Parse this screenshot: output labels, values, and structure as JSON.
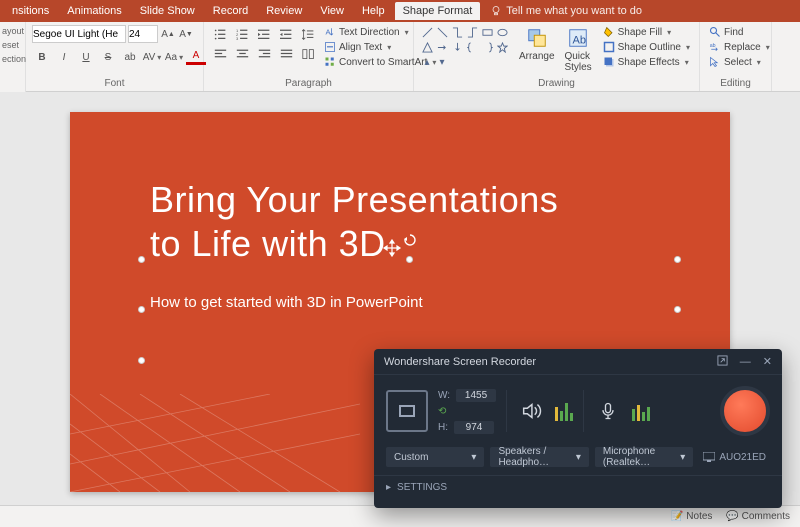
{
  "menu": {
    "items": [
      "nsitions",
      "Animations",
      "Slide Show",
      "Record",
      "Review",
      "View",
      "Help",
      "Shape Format"
    ],
    "active_index": 7,
    "tell_me": "Tell me what you want to do"
  },
  "left_stub": {
    "a": "ayout",
    "b": "eset",
    "c": "ection"
  },
  "ribbon": {
    "font": {
      "label": "Font",
      "family": "Segoe UI Light (He",
      "size": "24",
      "bold": "B",
      "italic": "I",
      "underline": "U",
      "strike": "S"
    },
    "paragraph": {
      "label": "Paragraph",
      "text_direction": "Text Direction",
      "align_text": "Align Text",
      "convert_smartart": "Convert to SmartArt"
    },
    "drawing": {
      "label": "Drawing",
      "arrange": "Arrange",
      "quick_styles": "Quick\nStyles",
      "shape_fill": "Shape Fill",
      "shape_outline": "Shape Outline",
      "shape_effects": "Shape Effects"
    },
    "editing": {
      "label": "Editing",
      "find": "Find",
      "replace": "Replace",
      "select": "Select"
    }
  },
  "slide": {
    "title": "Bring Your Presentations\nto Life with 3D",
    "subtitle": "How to get started with 3D in PowerPoint"
  },
  "status": {
    "notes": "Notes",
    "comments": "Comments"
  },
  "recorder": {
    "title": "Wondershare Screen Recorder",
    "w_label": "W:",
    "h_label": "H:",
    "lock_icon": "link-icon",
    "width": "1455",
    "height": "974",
    "custom": "Custom",
    "speakers": "Speakers / Headpho…",
    "mic": "Microphone (Realtek…",
    "monitor": "AUO21ED",
    "settings": "SETTINGS"
  }
}
